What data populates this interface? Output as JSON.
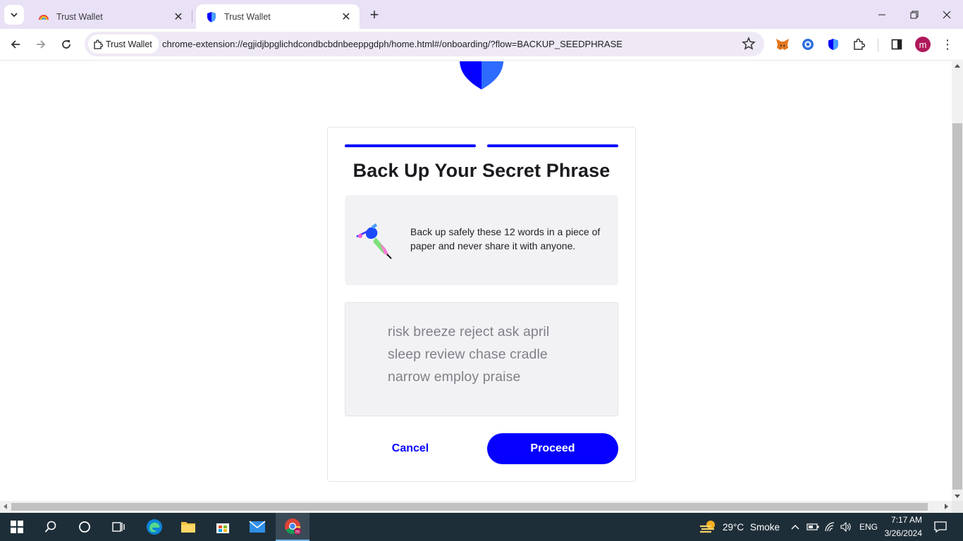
{
  "browser": {
    "tabs": [
      {
        "title": "Trust Wallet",
        "active": false
      },
      {
        "title": "Trust Wallet",
        "active": true
      }
    ],
    "site_chip": "Trust Wallet",
    "url": "chrome-extension://egjidjbpglichdcondbcbdnbeeppgdph/home.html#/onboarding/?flow=BACKUP_SEEDPHRASE",
    "profile_initial": "m",
    "extensions": [
      "metamask-icon",
      "circle-extension-icon",
      "trust-wallet-shield-icon",
      "puzzle-icon"
    ]
  },
  "page": {
    "title": "Back Up Your Secret Phrase",
    "info_text": "Back up safely these 12 words in a piece of paper and never share it with anyone.",
    "phrase_lines": [
      "risk breeze reject ask april",
      "sleep review chase cradle",
      "narrow employ praise"
    ],
    "progress_steps": 2,
    "cancel_label": "Cancel",
    "proceed_label": "Proceed",
    "accent_color": "#0500ff"
  },
  "taskbar": {
    "weather_temp": "29°C",
    "weather_desc": "Smoke",
    "language": "ENG",
    "time": "7:17 AM",
    "date": "3/26/2024"
  }
}
